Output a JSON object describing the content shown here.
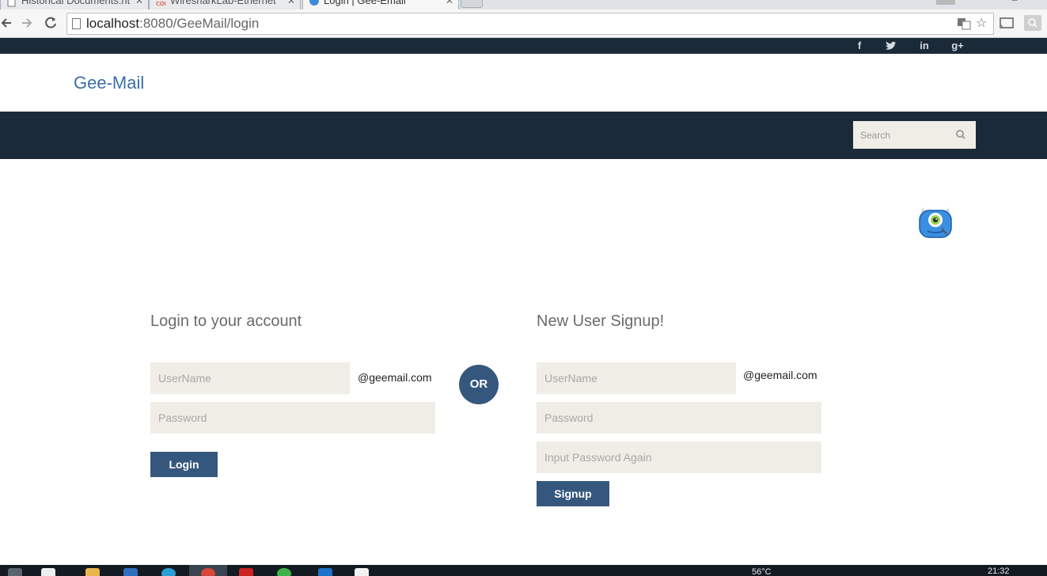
{
  "browser": {
    "tabs": [
      {
        "label": "Historical Documents.ht",
        "active": false
      },
      {
        "label": "WiresharkLab-Ethernet",
        "active": false
      },
      {
        "label": "Login | Gee-Email",
        "active": true
      }
    ],
    "url_host": "localhost",
    "url_path": ":8080/GeeMail/login"
  },
  "site": {
    "social": [
      "f",
      "t",
      "in",
      "g+"
    ],
    "brand": "Gee-Mail",
    "search_placeholder": "Search"
  },
  "login": {
    "title": "Login to your account",
    "username_placeholder": "UserName",
    "domain_suffix": "@geemail.com",
    "password_placeholder": "Password",
    "button": "Login"
  },
  "or_label": "OR",
  "signup": {
    "title": "New User Signup!",
    "username_placeholder": "UserName",
    "domain_suffix": "@geemail.com",
    "password_placeholder": "Password",
    "password_again_placeholder": "Input Password Again",
    "button": "Signup"
  },
  "taskbar": {
    "temperature": "56°C",
    "time": "21:32"
  },
  "colors": {
    "dark_bar": "#1b2a38",
    "brand": "#3b6fa6",
    "button": "#35577e",
    "field_bg": "#efede6"
  }
}
